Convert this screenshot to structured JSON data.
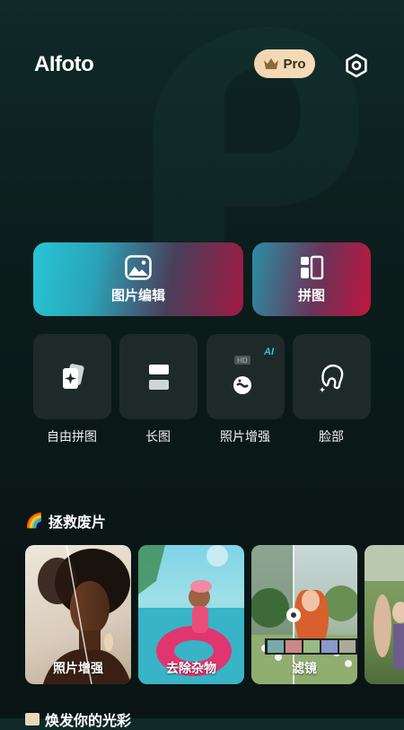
{
  "header": {
    "brand": "AIfoto",
    "pro_label": "Pro"
  },
  "main_actions": {
    "edit_label": "图片编辑",
    "collage_label": "拼图"
  },
  "tools": [
    {
      "label": "自由拼图",
      "icon": "cards-icon"
    },
    {
      "label": "长图",
      "icon": "long-image-icon"
    },
    {
      "label": "照片增强",
      "icon": "enhance-icon",
      "badge": "AI",
      "badge_sub": "HD"
    },
    {
      "label": "脸部",
      "icon": "face-icon"
    }
  ],
  "rescue": {
    "emoji": "🌈",
    "title": "拯救废片",
    "cards": [
      {
        "label": "照片增强"
      },
      {
        "label": "去除杂物"
      },
      {
        "label": "滤镜"
      },
      {
        "label": ""
      }
    ]
  },
  "next_section": {
    "title": "焕发你的光彩"
  },
  "colors": {
    "accent_cyan": "#27c6d6",
    "accent_red": "#c0163f",
    "pro_gold": "#f1d6b2",
    "tile_bg": "#1e2a2a"
  }
}
